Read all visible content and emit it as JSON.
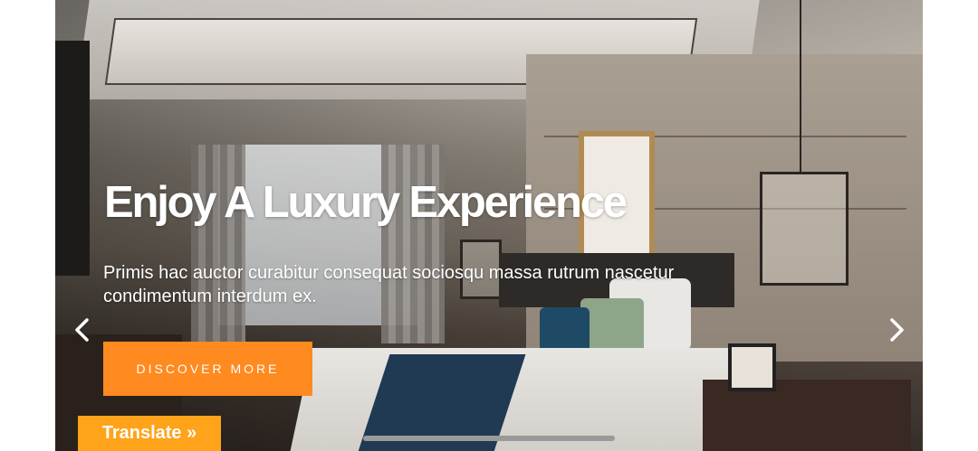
{
  "hero": {
    "headline": "Enjoy A Luxury Experience",
    "subtext": "Primis hac auctor curabitur consequat sociosqu massa rutrum nascetur condimentum interdum ex.",
    "cta_label": "DISCOVER MORE",
    "prev_icon": "chevron-left-icon",
    "next_icon": "chevron-right-icon"
  },
  "translate": {
    "label": "Translate »"
  },
  "colors": {
    "accent": "#ff8a1f",
    "translate": "#ffa31a",
    "text": "#ffffff"
  }
}
